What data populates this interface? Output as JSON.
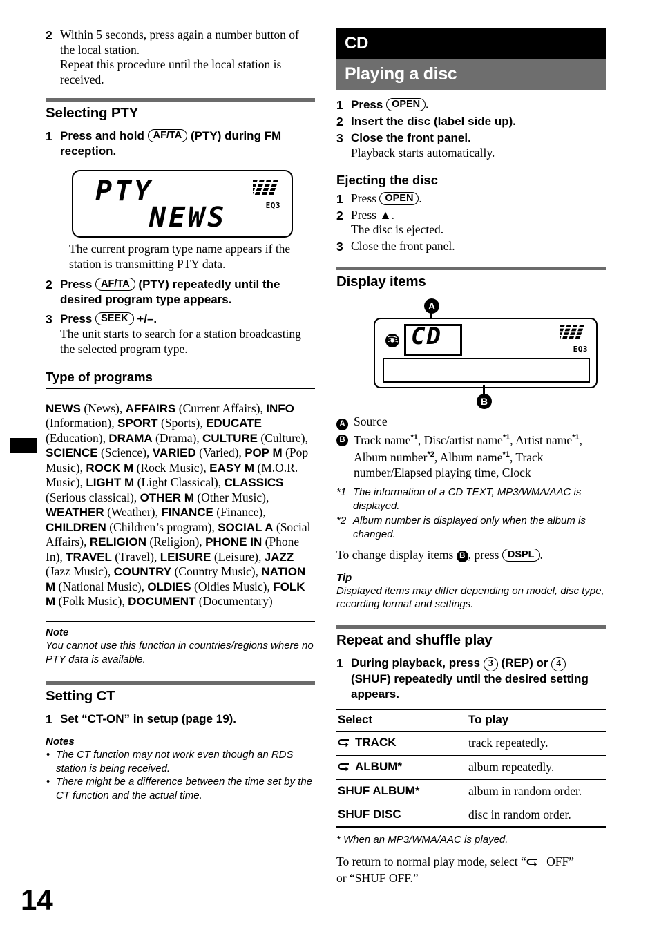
{
  "page": {
    "number": "14"
  },
  "left_column": {
    "step_continued": {
      "num": "2",
      "line1": "Within 5 seconds, press again a number button of the local station.",
      "line2": "Repeat this procedure until the local station is received."
    },
    "selecting_pty": {
      "heading": "Selecting PTY",
      "step1": {
        "num": "1",
        "pre": "Press and hold",
        "button": "AF/TA",
        "post": "(PTY) during FM reception."
      },
      "lcd": {
        "line1": "PTY",
        "line2": "NEWS",
        "eq_label": "EQ3"
      },
      "lcd_caption": "The current program type name appears if the station is transmitting PTY data.",
      "step2": {
        "num": "2",
        "pre": "Press",
        "button": "AF/TA",
        "post": "(PTY) repeatedly until the desired program type appears."
      },
      "step3": {
        "num": "3",
        "pre": "Press",
        "button": "SEEK",
        "post": "+/–.",
        "sub": "The unit starts to search for a station broadcasting the selected program type."
      }
    },
    "type_of_programs": {
      "heading": "Type of programs",
      "items": [
        {
          "code": "NEWS",
          "desc": "(News)"
        },
        {
          "code": "AFFAIRS",
          "desc": "(Current Affairs)"
        },
        {
          "code": "INFO",
          "desc": "(Information)"
        },
        {
          "code": "SPORT",
          "desc": "(Sports)"
        },
        {
          "code": "EDUCATE",
          "desc": "(Education)"
        },
        {
          "code": "DRAMA",
          "desc": "(Drama)"
        },
        {
          "code": "CULTURE",
          "desc": "(Culture)"
        },
        {
          "code": "SCIENCE",
          "desc": "(Science)"
        },
        {
          "code": "VARIED",
          "desc": "(Varied)"
        },
        {
          "code": "POP M",
          "desc": "(Pop Music)"
        },
        {
          "code": "ROCK M",
          "desc": "(Rock Music)"
        },
        {
          "code": "EASY M",
          "desc": "(M.O.R. Music)"
        },
        {
          "code": "LIGHT M",
          "desc": "(Light Classical)"
        },
        {
          "code": "CLASSICS",
          "desc": "(Serious classical)"
        },
        {
          "code": "OTHER M",
          "desc": "(Other Music)"
        },
        {
          "code": "WEATHER",
          "desc": "(Weather)"
        },
        {
          "code": "FINANCE",
          "desc": "(Finance)"
        },
        {
          "code": "CHILDREN",
          "desc": "(Children’s program)"
        },
        {
          "code": "SOCIAL A",
          "desc": "(Social Affairs)"
        },
        {
          "code": "RELIGION",
          "desc": "(Religion)"
        },
        {
          "code": "PHONE IN",
          "desc": "(Phone In)"
        },
        {
          "code": "TRAVEL",
          "desc": "(Travel)"
        },
        {
          "code": "LEISURE",
          "desc": "(Leisure)"
        },
        {
          "code": "JAZZ",
          "desc": "(Jazz Music)"
        },
        {
          "code": "COUNTRY",
          "desc": "(Country Music)"
        },
        {
          "code": "NATION M",
          "desc": "(National Music)"
        },
        {
          "code": "OLDIES",
          "desc": "(Oldies Music)"
        },
        {
          "code": "FOLK M",
          "desc": "(Folk Music)"
        },
        {
          "code": "DOCUMENT",
          "desc": "(Documentary)"
        }
      ],
      "note_head": "Note",
      "note_body": "You cannot use this function in countries/regions where no PTY data is available."
    },
    "setting_ct": {
      "heading": "Setting CT",
      "step1": {
        "num": "1",
        "text": "Set “CT-ON” in setup (page 19)."
      },
      "notes_head": "Notes",
      "notes": [
        "The CT function may not work even though an RDS station is being received.",
        "There might be a difference between the time set by the CT function and the actual time."
      ]
    }
  },
  "right_column": {
    "chapter_banner": "CD",
    "section_banner": "Playing a disc",
    "playing_steps": [
      {
        "num": "1",
        "pre": "Press",
        "button": "OPEN",
        "post": ".",
        "sub": ""
      },
      {
        "num": "2",
        "pre": "Insert the disc (label side up).",
        "button": "",
        "post": "",
        "sub": ""
      },
      {
        "num": "3",
        "pre": "Close the front panel.",
        "button": "",
        "post": "",
        "sub": "Playback starts automatically."
      }
    ],
    "ejecting": {
      "heading": "Ejecting the disc",
      "steps": [
        {
          "num": "1",
          "pre": "Press",
          "button": "OPEN",
          "post": ".",
          "sub": ""
        },
        {
          "num": "2",
          "pre": "Press",
          "button": "",
          "post": "▲.",
          "sub": "The disc is ejected."
        },
        {
          "num": "3",
          "pre": "Close the front panel.",
          "button": "",
          "post": "",
          "sub": ""
        }
      ]
    },
    "display_items": {
      "heading": "Display items",
      "figure": {
        "callout_a": "A",
        "callout_b": "B",
        "source_text": "CD",
        "eq_label": "EQ3"
      },
      "definitions": [
        {
          "label": "A",
          "text": "Source"
        },
        {
          "label": "B",
          "text": "Track name*1, Disc/artist name*1, Artist name*1, Album number*2, Album name*1, Track number/Elapsed playing time, Clock"
        }
      ],
      "footnotes": [
        {
          "mark": "*1",
          "text": "The information of a CD TEXT, MP3/WMA/AAC is displayed."
        },
        {
          "mark": "*2",
          "text": "Album number is displayed only when the album is changed."
        }
      ],
      "change_line": {
        "pre": "To change display items",
        "badge": "B",
        "mid": ", press",
        "button": "DSPL",
        "post": "."
      },
      "tip_head": "Tip",
      "tip_body": "Displayed items may differ depending on model, disc type, recording format and settings."
    },
    "repeat_shuffle": {
      "heading": "Repeat and shuffle play",
      "step1": {
        "num": "1",
        "pre": "During playback, press",
        "button1": "3",
        "mid1": "(REP) or",
        "button2": "4",
        "post": "(SHUF) repeatedly until the desired setting appears."
      },
      "table": {
        "headers": [
          "Select",
          "To play"
        ],
        "rows": [
          {
            "icon": "repeat-icon",
            "select": "TRACK",
            "star": "",
            "play": "track repeatedly."
          },
          {
            "icon": "repeat-icon",
            "select": "ALBUM",
            "star": "*",
            "play": "album repeatedly."
          },
          {
            "icon": "",
            "select": "SHUF ALBUM",
            "star": "*",
            "play": "album in random order."
          },
          {
            "icon": "",
            "select": "SHUF DISC",
            "star": "",
            "play": "disc in random order."
          }
        ]
      },
      "table_footnote": "* When an MP3/WMA/AAC is played.",
      "closing": {
        "pre": "To return to normal play mode, select “",
        "icon": "repeat-icon",
        "mid": " OFF”",
        "post": "or “SHUF OFF.”"
      }
    }
  }
}
